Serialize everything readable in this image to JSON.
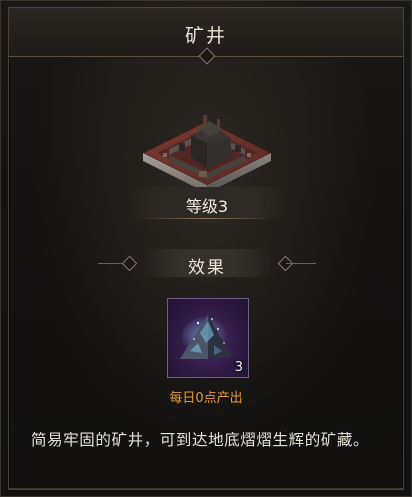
{
  "header": {
    "title": "矿井"
  },
  "building": {
    "level_label": "等级3",
    "image_icon": "mine-building-icon"
  },
  "effect": {
    "section_label": "效果",
    "item": {
      "icon": "ore-crystal-icon",
      "count": "3",
      "caption": "每日0点产出",
      "caption_color": "#e39a3a",
      "slot_color": "#3a2052"
    }
  },
  "description": {
    "text": "简易牢固的矿井，可到达地底熠熠生辉的矿藏。"
  }
}
